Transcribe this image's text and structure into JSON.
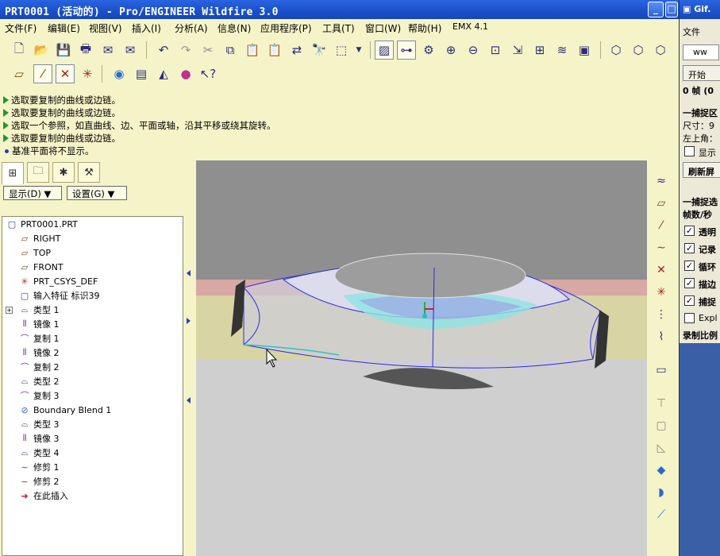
{
  "window": {
    "title": "PRT0001 (活动的) - Pro/ENGINEER Wildfire 3.0",
    "min_label": "_",
    "max_label": "□"
  },
  "menu": [
    "文件(F)",
    "编辑(E)",
    "视图(V)",
    "插入(I)",
    "分析(A)",
    "信息(N)",
    "应用程序(P)",
    "工具(T)",
    "窗口(W)",
    "帮助(H)",
    "EMX 4.1"
  ],
  "messages": [
    {
      "type": "arrow",
      "text": "选取要复制的曲线或边链。"
    },
    {
      "type": "arrow",
      "text": "选取要复制的曲线或边链。"
    },
    {
      "type": "arrow",
      "text": "选取一个参照，如直曲线、边、平面或轴，沿其平移或绕其旋转。"
    },
    {
      "type": "arrow",
      "text": "选取要复制的曲线或边链。"
    },
    {
      "type": "dot",
      "text": "基准平面将不显示。"
    }
  ],
  "panel": {
    "show_label": "显示(D) ▼",
    "settings_label": "设置(G) ▼"
  },
  "tree": {
    "root": "PRT0001.PRT",
    "items": [
      {
        "icon": "datum-plane-icon",
        "label": "RIGHT"
      },
      {
        "icon": "datum-plane-icon",
        "label": "TOP"
      },
      {
        "icon": "datum-plane-icon",
        "label": "FRONT"
      },
      {
        "icon": "csys-icon",
        "label": "PRT_CSYS_DEF"
      },
      {
        "icon": "import-feature-icon",
        "label": "输入特征 标识39"
      },
      {
        "icon": "type-feature-icon",
        "label": "类型 1"
      },
      {
        "icon": "mirror-icon",
        "label": "镜像 1"
      },
      {
        "icon": "copy-icon",
        "label": "复制 1"
      },
      {
        "icon": "mirror-icon",
        "label": "镜像 2"
      },
      {
        "icon": "copy-icon",
        "label": "复制 2"
      },
      {
        "icon": "type-feature-icon",
        "label": "类型 2"
      },
      {
        "icon": "copy-icon",
        "label": "复制 3"
      },
      {
        "icon": "boundary-blend-icon",
        "label": "Boundary Blend 1"
      },
      {
        "icon": "type-feature-icon",
        "label": "类型 3"
      },
      {
        "icon": "mirror-icon",
        "label": "镜像 3"
      },
      {
        "icon": "type-feature-icon",
        "label": "类型 4"
      },
      {
        "icon": "trim-icon",
        "label": "修剪 1"
      },
      {
        "icon": "trim-icon",
        "label": "修剪 2"
      },
      {
        "icon": "insert-here-icon",
        "label": "在此插入"
      }
    ]
  },
  "gif_tool": {
    "title": "Gif.",
    "menu_file": "文件",
    "url_box": "ww",
    "start_button": "开始",
    "frames": "0 帧 (0 ",
    "capture_area": "一捕捉区",
    "size": "尺寸：9",
    "top_left": "左上角：",
    "show": "显示",
    "refresh": "刷新屏",
    "capture_opts": "一捕捉选",
    "fps": "帧数/秒",
    "checks": [
      {
        "label": "透明",
        "checked": true
      },
      {
        "label": "记录",
        "checked": true
      },
      {
        "label": "循环",
        "checked": true
      },
      {
        "label": "描边",
        "checked": true
      },
      {
        "label": "捕捉",
        "checked": true
      },
      {
        "label": "Expl",
        "checked": false
      }
    ],
    "ratio": "录制比例",
    "check_mark": "✓"
  },
  "colors": {
    "ui_bg": "#f5f4c8",
    "titlebar": "#1a4fc8",
    "viewport_bg": "#cfcfcf",
    "surface_edge": "#2a2ae0",
    "highlight": "#26c6c6"
  }
}
